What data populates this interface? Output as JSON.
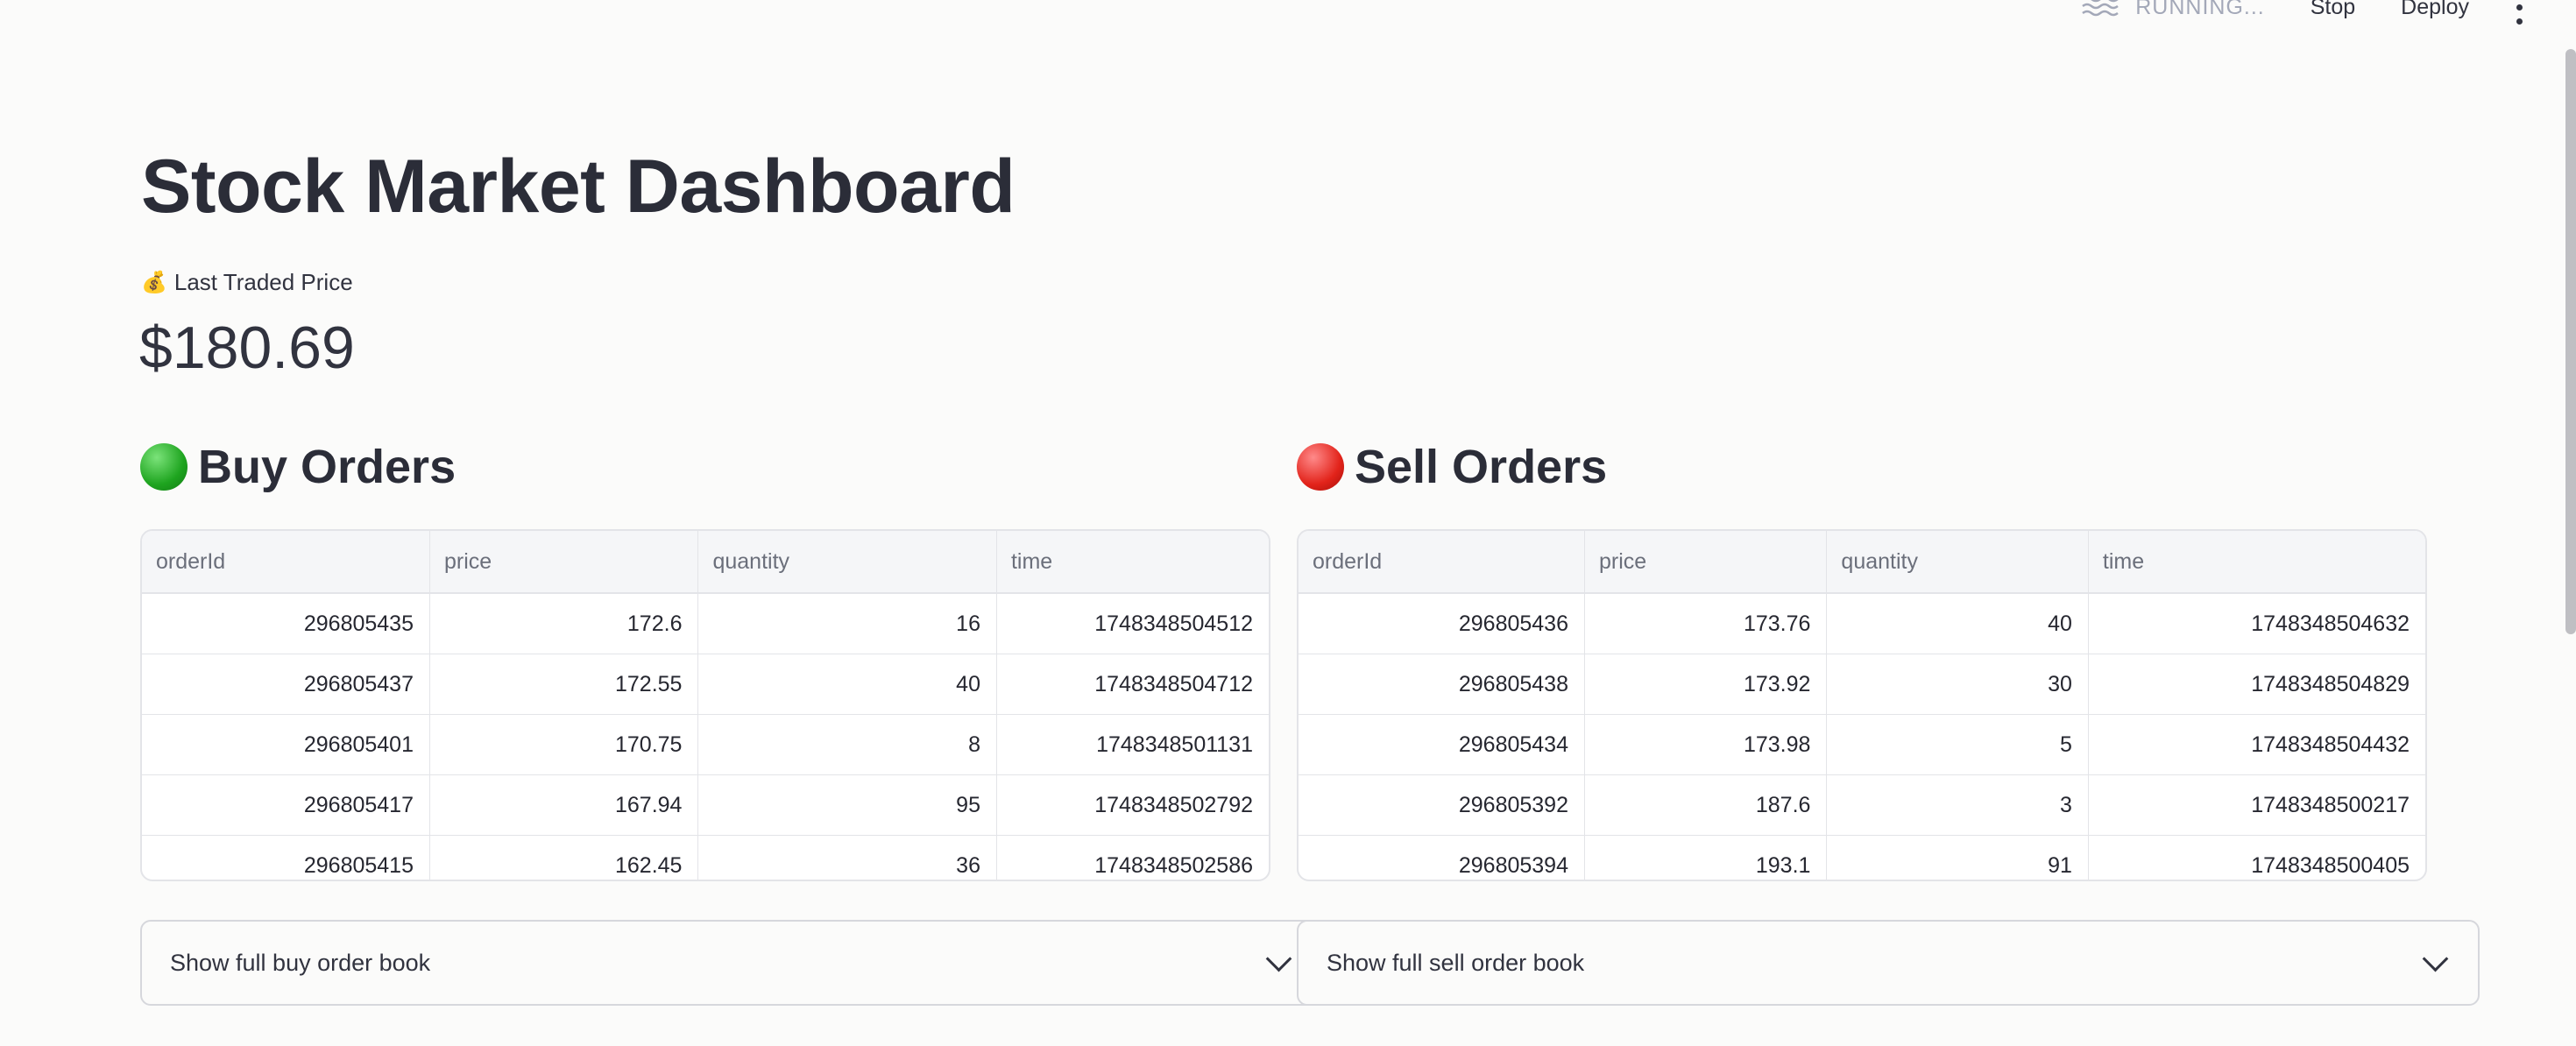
{
  "toolbar": {
    "status_icon": "running-waves-icon",
    "status_label": "RUNNING...",
    "stop_label": "Stop",
    "deploy_label": "Deploy",
    "menu_icon": "kebab-menu-icon"
  },
  "page": {
    "title": "Stock Market Dashboard"
  },
  "metric": {
    "icon": "💰",
    "label": "Last Traded Price",
    "value": "$180.69"
  },
  "buy": {
    "icon": "🟢",
    "title": "Buy Orders",
    "columns": [
      "orderId",
      "price",
      "quantity",
      "time"
    ],
    "rows": [
      [
        "296805435",
        "172.6",
        "16",
        "1748348504512"
      ],
      [
        "296805437",
        "172.55",
        "40",
        "1748348504712"
      ],
      [
        "296805401",
        "170.75",
        "8",
        "1748348501131"
      ],
      [
        "296805417",
        "167.94",
        "95",
        "1748348502792"
      ],
      [
        "296805415",
        "162.45",
        "36",
        "1748348502586"
      ]
    ],
    "expander_label": "Show full buy order book"
  },
  "sell": {
    "icon": "🔴",
    "title": "Sell Orders",
    "columns": [
      "orderId",
      "price",
      "quantity",
      "time"
    ],
    "rows": [
      [
        "296805436",
        "173.76",
        "40",
        "1748348504632"
      ],
      [
        "296805438",
        "173.92",
        "30",
        "1748348504829"
      ],
      [
        "296805434",
        "173.98",
        "5",
        "1748348504432"
      ],
      [
        "296805392",
        "187.6",
        "3",
        "1748348500217"
      ],
      [
        "296805394",
        "193.1",
        "91",
        "1748348500405"
      ]
    ],
    "expander_label": "Show full sell order book"
  }
}
